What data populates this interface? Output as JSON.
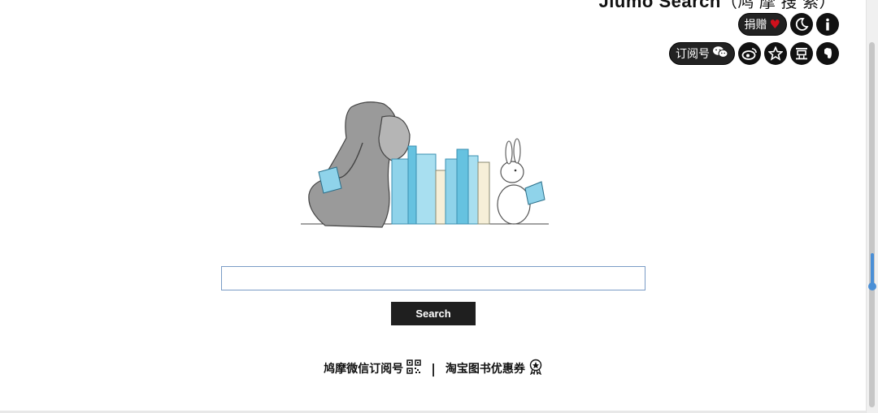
{
  "header": {
    "brand_title": "Jiumo Search",
    "brand_subtitle": "（鸠 摩 搜 索）",
    "donate_label": "捐赠",
    "subscribe_label": "订阅号"
  },
  "icons": {
    "heart": "heart-icon",
    "moon": "moon-icon",
    "info": "info-icon",
    "wechat": "wechat-icon",
    "weibo": "weibo-icon",
    "star": "star-icon",
    "douban": "douban-icon",
    "evernote": "evernote-icon",
    "qrcode": "qrcode-icon",
    "badge": "badge-icon"
  },
  "search": {
    "value": "",
    "placeholder": "",
    "button_label": "Search"
  },
  "footer_links": {
    "wechat_sub": "鸠摩微信订阅号",
    "separator": "|",
    "taobao_coupon": "淘宝图书优惠券"
  },
  "colors": {
    "accent_blue": "#4a8fd6",
    "heart_red": "#d0101c",
    "button_dark": "#1f1f1f"
  }
}
